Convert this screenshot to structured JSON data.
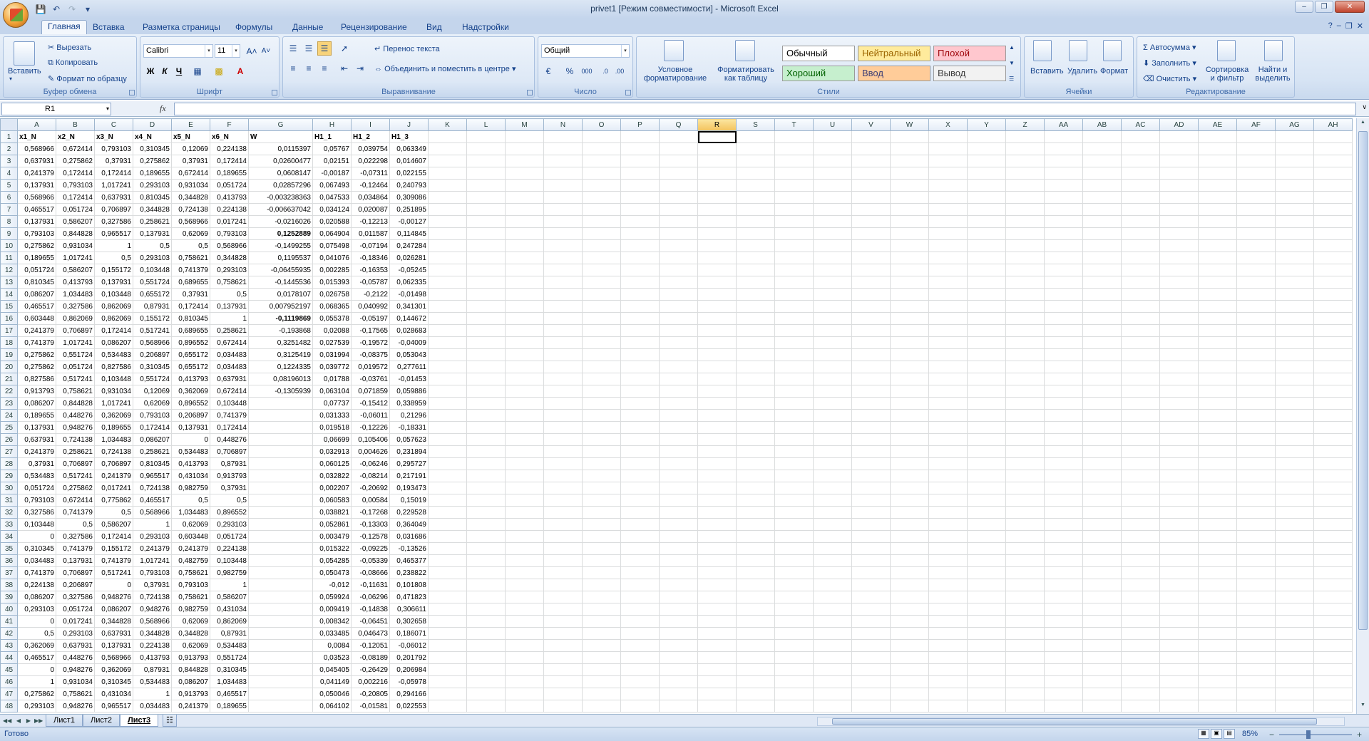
{
  "window": {
    "title": "privet1  [Режим совместимости] - Microsoft Excel"
  },
  "ribbon_tabs": [
    "Главная",
    "Вставка",
    "Разметка страницы",
    "Формулы",
    "Данные",
    "Рецензирование",
    "Вид",
    "Надстройки"
  ],
  "ribbon": {
    "clipboard": {
      "label": "Буфер обмена",
      "paste": "Вставить",
      "cut": "Вырезать",
      "copy": "Копировать",
      "format_painter": "Формат по образцу"
    },
    "font": {
      "label": "Шрифт",
      "family": "Calibri",
      "size": "11",
      "bold": "Ж",
      "italic": "К",
      "underline": "Ч"
    },
    "alignment": {
      "label": "Выравнивание",
      "wrap": "Перенос текста",
      "merge": "Объединить и поместить в центре"
    },
    "number": {
      "label": "Число",
      "format": "Общий",
      "percent": "%",
      "thousands": "000"
    },
    "styles": {
      "label": "Стили",
      "conditional": "Условное форматирование",
      "as_table": "Форматировать как таблицу",
      "cells": [
        {
          "text": "Обычный",
          "bg": "#ffffff",
          "fg": "#000000"
        },
        {
          "text": "Нейтральный",
          "bg": "#ffeb9c",
          "fg": "#9c6500"
        },
        {
          "text": "Плохой",
          "bg": "#ffc7ce",
          "fg": "#9c0006"
        },
        {
          "text": "Хороший",
          "bg": "#c6efce",
          "fg": "#006100"
        },
        {
          "text": "Ввод",
          "bg": "#ffcc99",
          "fg": "#3f3f76"
        },
        {
          "text": "Вывод",
          "bg": "#f2f2f2",
          "fg": "#3f3f3f"
        }
      ]
    },
    "cells": {
      "label": "Ячейки",
      "insert": "Вставить",
      "delete": "Удалить",
      "format": "Формат"
    },
    "editing": {
      "label": "Редактирование",
      "autosum": "Автосумма",
      "fill": "Заполнить",
      "clear": "Очистить",
      "sort": "Сортировка и фильтр",
      "find": "Найти и выделить"
    }
  },
  "formula_bar": {
    "name_box": "R1",
    "fx": "fx",
    "value": ""
  },
  "sheet": {
    "columns": [
      "A",
      "B",
      "C",
      "D",
      "E",
      "F",
      "G",
      "H",
      "I",
      "J",
      "K",
      "L",
      "M",
      "N",
      "O",
      "P",
      "Q",
      "R",
      "S",
      "T",
      "U",
      "V",
      "W",
      "X",
      "Y",
      "Z",
      "AA",
      "AB",
      "AC",
      "AD",
      "AE",
      "AF",
      "AG",
      "AH"
    ],
    "selected_column": "R",
    "header_row": [
      "x1_N",
      "x2_N",
      "x3_N",
      "x4_N",
      "x5_N",
      "x6_N",
      "W",
      "H1_1",
      "H1_2",
      "H1_3"
    ],
    "rows": [
      [
        "0,568966",
        "0,672414",
        "0,793103",
        "0,310345",
        "0,12069",
        "0,224138",
        "0,0115397",
        "0,05767",
        "0,039754",
        "0,063349"
      ],
      [
        "0,637931",
        "0,275862",
        "0,37931",
        "0,275862",
        "0,37931",
        "0,172414",
        "0,02600477",
        "0,02151",
        "0,022298",
        "0,014607"
      ],
      [
        "0,241379",
        "0,172414",
        "0,172414",
        "0,189655",
        "0,672414",
        "0,189655",
        "0,0608147",
        "-0,00187",
        "-0,07311",
        "0,022155"
      ],
      [
        "0,137931",
        "0,793103",
        "1,017241",
        "0,293103",
        "0,931034",
        "0,051724",
        "0,02857296",
        "0,067493",
        "-0,12464",
        "0,240793"
      ],
      [
        "0,568966",
        "0,172414",
        "0,637931",
        "0,810345",
        "0,344828",
        "0,413793",
        "-0,003238363",
        "0,047533",
        "0,034864",
        "0,309086"
      ],
      [
        "0,465517",
        "0,051724",
        "0,706897",
        "0,344828",
        "0,724138",
        "0,224138",
        "-0,006637042",
        "0,034124",
        "0,020087",
        "0,251895"
      ],
      [
        "0,137931",
        "0,586207",
        "0,327586",
        "0,258621",
        "0,568966",
        "0,017241",
        "-0,0216026",
        "0,020588",
        "-0,12213",
        "-0,00127"
      ],
      [
        "0,793103",
        "0,844828",
        "0,965517",
        "0,137931",
        "0,62069",
        "0,793103",
        "0,1252889",
        "0,064904",
        "0,011587",
        "0,114845"
      ],
      [
        "0,275862",
        "0,931034",
        "1",
        "0,5",
        "0,5",
        "0,568966",
        "-0,1499255",
        "0,075498",
        "-0,07194",
        "0,247284"
      ],
      [
        "0,189655",
        "1,017241",
        "0,5",
        "0,293103",
        "0,758621",
        "0,344828",
        "0,1195537",
        "0,041076",
        "-0,18346",
        "0,026281"
      ],
      [
        "0,051724",
        "0,586207",
        "0,155172",
        "0,103448",
        "0,741379",
        "0,293103",
        "-0,06455935",
        "0,002285",
        "-0,16353",
        "-0,05245"
      ],
      [
        "0,810345",
        "0,413793",
        "0,137931",
        "0,551724",
        "0,689655",
        "0,758621",
        "-0,1445536",
        "0,015393",
        "-0,05787",
        "0,062335"
      ],
      [
        "0,086207",
        "1,034483",
        "0,103448",
        "0,655172",
        "0,37931",
        "0,5",
        "0,0178107",
        "0,026758",
        "-0,2122",
        "-0,01498"
      ],
      [
        "0,465517",
        "0,327586",
        "0,862069",
        "0,87931",
        "0,172414",
        "0,137931",
        "0,007952197",
        "0,068365",
        "0,040992",
        "0,341301"
      ],
      [
        "0,603448",
        "0,862069",
        "0,862069",
        "0,155172",
        "0,810345",
        "1",
        "-0,1119869",
        "0,055378",
        "-0,05197",
        "0,144672"
      ],
      [
        "0,241379",
        "0,706897",
        "0,172414",
        "0,517241",
        "0,689655",
        "0,258621",
        "-0,193868",
        "0,02088",
        "-0,17565",
        "0,028683"
      ],
      [
        "0,741379",
        "1,017241",
        "0,086207",
        "0,568966",
        "0,896552",
        "0,672414",
        "0,3251482",
        "0,027539",
        "-0,19572",
        "-0,04009"
      ],
      [
        "0,275862",
        "0,551724",
        "0,534483",
        "0,206897",
        "0,655172",
        "0,034483",
        "0,3125419",
        "0,031994",
        "-0,08375",
        "0,053043"
      ],
      [
        "0,275862",
        "0,051724",
        "0,827586",
        "0,310345",
        "0,655172",
        "0,034483",
        "0,1224335",
        "0,039772",
        "0,019572",
        "0,277611"
      ],
      [
        "0,827586",
        "0,517241",
        "0,103448",
        "0,551724",
        "0,413793",
        "0,637931",
        "0,08196013",
        "0,01788",
        "-0,03761",
        "-0,01453"
      ],
      [
        "0,913793",
        "0,758621",
        "0,931034",
        "0,12069",
        "0,362069",
        "0,672414",
        "-0,1305939",
        "0,063104",
        "0,071859",
        "0,059886"
      ],
      [
        "0,086207",
        "0,844828",
        "1,017241",
        "0,62069",
        "0,896552",
        "0,103448",
        "",
        "0,07737",
        "-0,15412",
        "0,338959"
      ],
      [
        "0,189655",
        "0,448276",
        "0,362069",
        "0,793103",
        "0,206897",
        "0,741379",
        "",
        "0,031333",
        "-0,06011",
        "0,21296"
      ],
      [
        "0,137931",
        "0,948276",
        "0,189655",
        "0,172414",
        "0,137931",
        "0,172414",
        "",
        "0,019518",
        "-0,12226",
        "-0,18331"
      ],
      [
        "0,637931",
        "0,724138",
        "1,034483",
        "0,086207",
        "0",
        "0,448276",
        "",
        "0,06699",
        "0,105406",
        "0,057623"
      ],
      [
        "0,241379",
        "0,258621",
        "0,724138",
        "0,258621",
        "0,534483",
        "0,706897",
        "",
        "0,032913",
        "0,004626",
        "0,231894"
      ],
      [
        "0,37931",
        "0,706897",
        "0,706897",
        "0,810345",
        "0,413793",
        "0,87931",
        "",
        "0,060125",
        "-0,06246",
        "0,295727"
      ],
      [
        "0,534483",
        "0,517241",
        "0,241379",
        "0,965517",
        "0,431034",
        "0,913793",
        "",
        "0,032822",
        "-0,08214",
        "0,217191"
      ],
      [
        "0,051724",
        "0,275862",
        "0,017241",
        "0,724138",
        "0,982759",
        "0,37931",
        "",
        "0,002207",
        "-0,20692",
        "0,193473"
      ],
      [
        "0,793103",
        "0,672414",
        "0,775862",
        "0,465517",
        "0,5",
        "0,5",
        "",
        "0,060583",
        "0,00584",
        "0,15019"
      ],
      [
        "0,327586",
        "0,741379",
        "0,5",
        "0,568966",
        "1,034483",
        "0,896552",
        "",
        "0,038821",
        "-0,17268",
        "0,229528"
      ],
      [
        "0,103448",
        "0,5",
        "0,586207",
        "1",
        "0,62069",
        "0,293103",
        "",
        "0,052861",
        "-0,13303",
        "0,364049"
      ],
      [
        "0",
        "0,327586",
        "0,172414",
        "0,293103",
        "0,603448",
        "0,051724",
        "",
        "0,003479",
        "-0,12578",
        "0,031686"
      ],
      [
        "0,310345",
        "0,741379",
        "0,155172",
        "0,241379",
        "0,241379",
        "0,224138",
        "",
        "0,015322",
        "-0,09225",
        "-0,13526"
      ],
      [
        "0,034483",
        "0,137931",
        "0,741379",
        "1,017241",
        "0,482759",
        "0,103448",
        "",
        "0,054285",
        "-0,05339",
        "0,465377"
      ],
      [
        "0,741379",
        "0,706897",
        "0,517241",
        "0,793103",
        "0,758621",
        "0,982759",
        "",
        "0,050473",
        "-0,08666",
        "0,238822"
      ],
      [
        "0,224138",
        "0,206897",
        "0",
        "0,37931",
        "0,793103",
        "1",
        "",
        "-0,012",
        "-0,11631",
        "0,101808"
      ],
      [
        "0,086207",
        "0,327586",
        "0,948276",
        "0,724138",
        "0,758621",
        "0,586207",
        "",
        "0,059924",
        "-0,06296",
        "0,471823"
      ],
      [
        "0,293103",
        "0,051724",
        "0,086207",
        "0,948276",
        "0,982759",
        "0,431034",
        "",
        "0,009419",
        "-0,14838",
        "0,306611"
      ],
      [
        "0",
        "0,017241",
        "0,344828",
        "0,568966",
        "0,62069",
        "0,862069",
        "",
        "0,008342",
        "-0,06451",
        "0,302658"
      ],
      [
        "0,5",
        "0,293103",
        "0,637931",
        "0,344828",
        "0,344828",
        "0,87931",
        "",
        "0,033485",
        "0,046473",
        "0,186071"
      ],
      [
        "0,362069",
        "0,637931",
        "0,137931",
        "0,224138",
        "0,62069",
        "0,534483",
        "",
        "0,0084",
        "-0,12051",
        "-0,06012"
      ],
      [
        "0,465517",
        "0,448276",
        "0,568966",
        "0,413793",
        "0,913793",
        "0,551724",
        "",
        "0,03523",
        "-0,08189",
        "0,201792"
      ],
      [
        "0",
        "0,948276",
        "0,362069",
        "0,87931",
        "0,844828",
        "0,310345",
        "",
        "0,045405",
        "-0,26429",
        "0,206984"
      ],
      [
        "1",
        "0,931034",
        "0,310345",
        "0,534483",
        "0,086207",
        "1,034483",
        "",
        "0,041149",
        "0,002216",
        "-0,05978"
      ],
      [
        "0,275862",
        "0,758621",
        "0,431034",
        "1",
        "0,913793",
        "0,465517",
        "",
        "0,050046",
        "-0,20805",
        "0,294166"
      ],
      [
        "0,293103",
        "0,948276",
        "0,965517",
        "0,034483",
        "0,241379",
        "0,189655",
        "",
        "0,064102",
        "-0,01581",
        "0,022553"
      ]
    ],
    "bold_w_rows": [
      7,
      14,
      21
    ]
  },
  "sheet_tabs": [
    "Лист1",
    "Лист2",
    "Лист3"
  ],
  "active_sheet": "Лист3",
  "status": {
    "text": "Готово",
    "zoom": "85%"
  }
}
